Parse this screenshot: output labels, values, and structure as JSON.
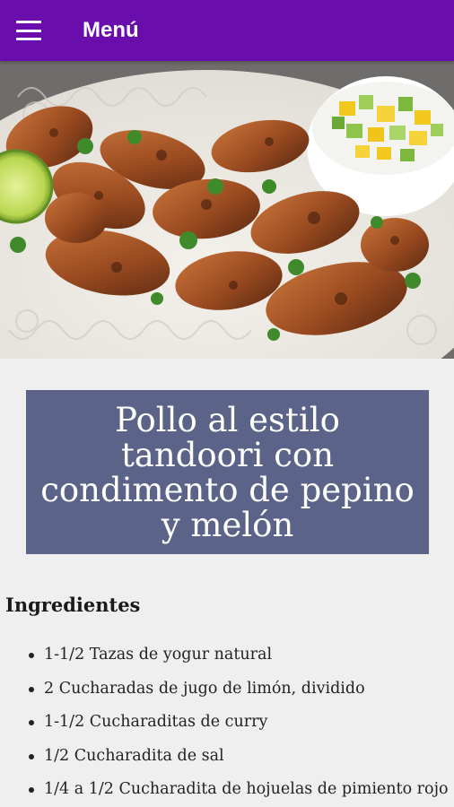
{
  "app_bar": {
    "title": "Menú",
    "menu_icon": "hamburger-menu-icon",
    "color": "#6a0dad"
  },
  "hero": {
    "image": "tandoori-chicken-photo"
  },
  "recipe": {
    "title": "Pollo al estilo tandoori con condimento de pepino y melón",
    "title_bg": "#5b6389"
  },
  "ingredients": {
    "heading": "Ingredientes",
    "items": [
      "1-1/2 Tazas de yogur natural",
      "2 Cucharadas de jugo de limón, dividido",
      "1-1/2 Cucharaditas de curry",
      "1/2 Cucharadita de sal",
      "1/4 a 1/2 Cucharadita de hojuelas de pimiento rojo"
    ]
  }
}
